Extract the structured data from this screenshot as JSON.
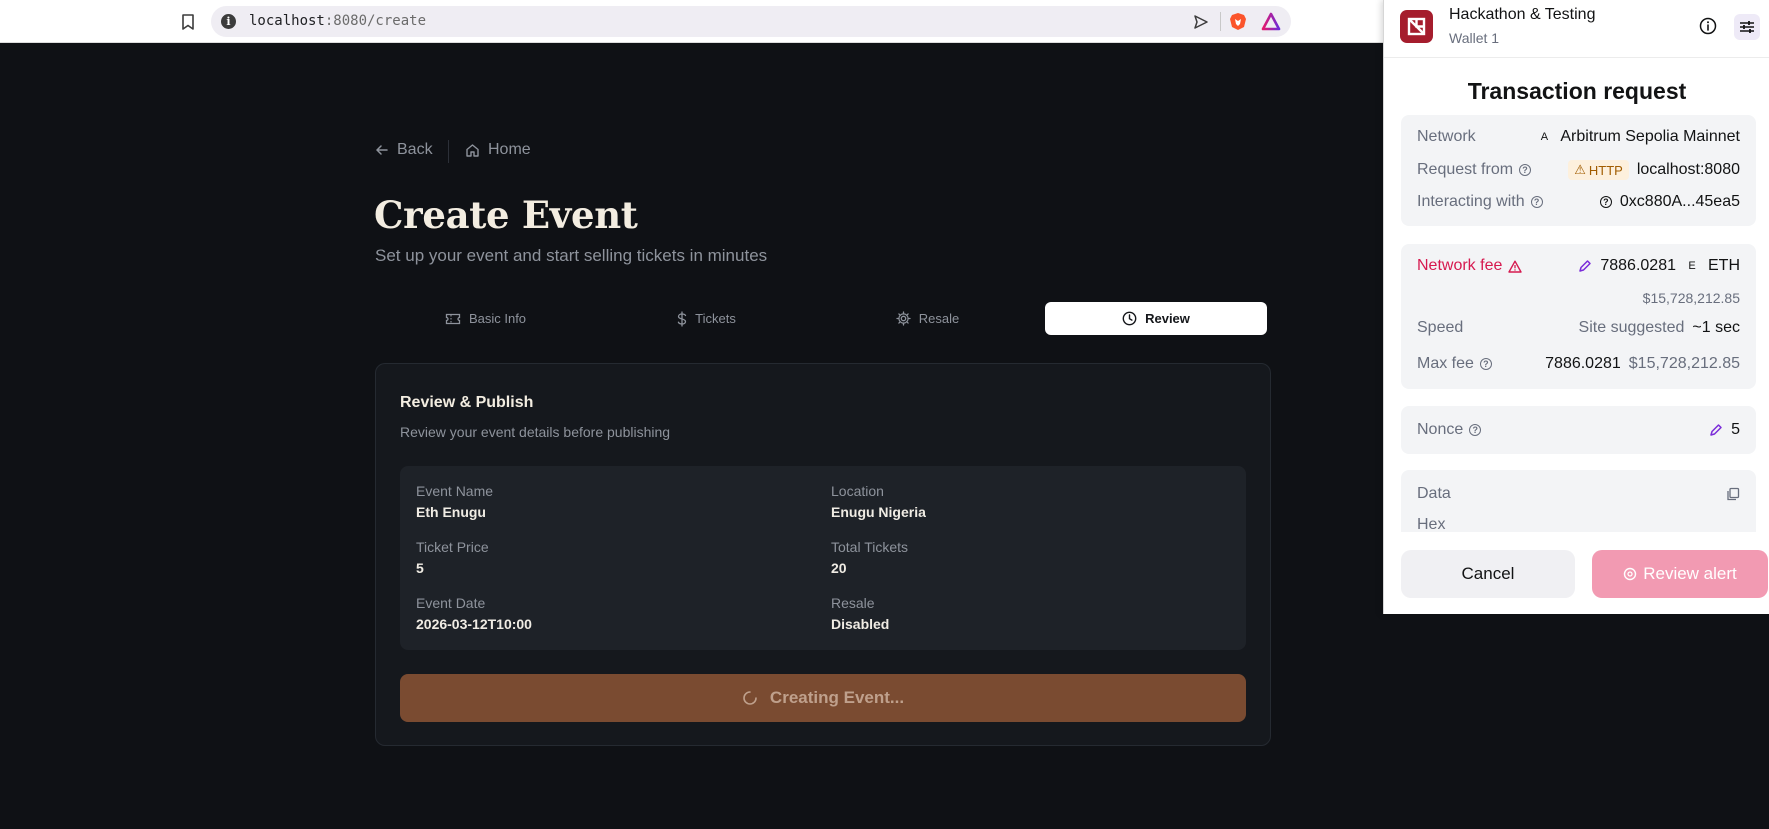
{
  "browser": {
    "url_host": "localhost",
    "url_rest": ":8080/create"
  },
  "page": {
    "back_label": "Back",
    "home_label": "Home",
    "title": "Create Event",
    "subtitle": "Set up your event and start selling tickets in minutes",
    "tabs": [
      {
        "label": "Basic Info",
        "icon": "ticket-icon"
      },
      {
        "label": "Tickets",
        "icon": "dollar-icon"
      },
      {
        "label": "Resale",
        "icon": "gear-icon"
      },
      {
        "label": "Review",
        "icon": "clock-icon",
        "active": true
      }
    ],
    "card": {
      "title": "Review & Publish",
      "subtitle": "Review your event details before publishing",
      "fields": [
        {
          "label": "Event Name",
          "value": "Eth Enugu"
        },
        {
          "label": "Location",
          "value": "Enugu Nigeria"
        },
        {
          "label": "Ticket Price",
          "value": "5"
        },
        {
          "label": "Total Tickets",
          "value": "20"
        },
        {
          "label": "Event Date",
          "value": "2026-03-12T10:00"
        },
        {
          "label": "Resale",
          "value": "Disabled"
        }
      ],
      "submit_label": "Creating Event..."
    }
  },
  "wallet": {
    "account": "Hackathon & Testing",
    "wallet_name": "Wallet 1",
    "title": "Transaction request",
    "network_label": "Network",
    "network_icon_letter": "A",
    "network_value": "Arbitrum Sepolia Mainnet",
    "request_from_label": "Request from",
    "http_badge": "HTTP",
    "request_from_value": "localhost:8080",
    "interacting_label": "Interacting with",
    "interacting_value": "0xc880A...45ea5",
    "network_fee_label": "Network fee",
    "network_fee_value": "7886.0281",
    "eth_icon_letter": "E",
    "network_fee_unit": "ETH",
    "network_fee_fiat": "$15,728,212.85",
    "speed_label": "Speed",
    "speed_source": "Site suggested",
    "speed_value": "~1 sec",
    "max_fee_label": "Max fee",
    "max_fee_value": "7886.0281",
    "max_fee_fiat": "$15,728,212.85",
    "nonce_label": "Nonce",
    "nonce_value": "5",
    "data_label": "Data",
    "hex_label": "Hex",
    "cancel_label": "Cancel",
    "review_label": "Review alert",
    "colors": {
      "danger": "#d6194f",
      "accent": "#f29ab2",
      "brand": "#a51d2d"
    }
  }
}
